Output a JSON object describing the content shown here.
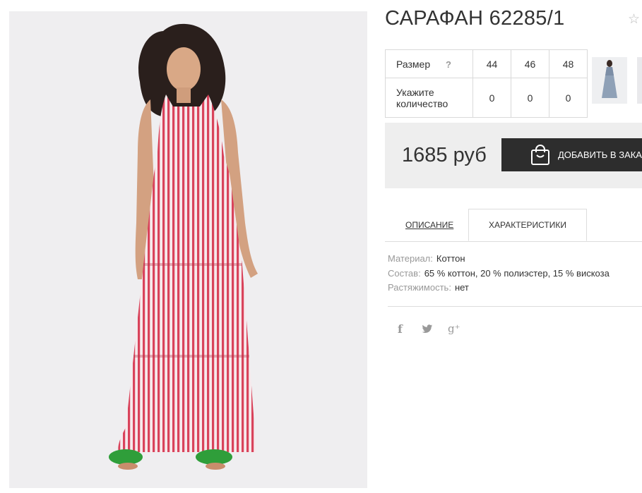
{
  "product": {
    "title": "САРАФАН 62285/1",
    "favorite_icon": "star-outline-icon"
  },
  "sizes": {
    "size_label": "Размер",
    "help_label": "?",
    "qty_label": "Укажите количество",
    "columns": [
      "44",
      "46",
      "48"
    ],
    "quantities": [
      "0",
      "0",
      "0"
    ]
  },
  "price": {
    "value": "1685 руб",
    "order_button_label": "ДОБАВИТЬ В ЗАКАЗ",
    "order_icon": "shopping-bag-icon"
  },
  "tabs": {
    "description": "ОПИСАНИЕ",
    "characteristics": "ХАРАКТЕРИСТИКИ",
    "active": "characteristics"
  },
  "specs": [
    {
      "key": "Материал:",
      "value": "Коттон"
    },
    {
      "key": "Состав:",
      "value": "65 % коттон, 20 % полиэстер, 15 % вискоза"
    },
    {
      "key": "Растяжимость:",
      "value": "нет"
    }
  ],
  "social": {
    "facebook": "f",
    "googleplus": "g⁺",
    "icons": [
      "facebook-icon",
      "twitter-icon",
      "google-plus-icon"
    ]
  },
  "colors": {
    "accent": "#2d2d2d",
    "price_bg": "#eeeeee",
    "dress_stripe": "#d9435b",
    "muted": "#999999"
  }
}
